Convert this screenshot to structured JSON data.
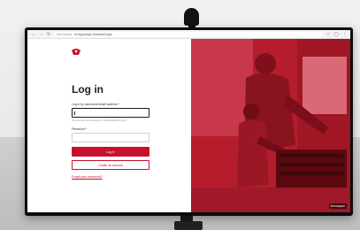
{
  "browser": {
    "secure_label": "Not secure",
    "url": "rb-loginpage.example/login"
  },
  "login": {
    "title": "Log in",
    "email_label": "Log in by username/email address *",
    "email_hint": "You can use your username or email address to log in",
    "password_label": "Password *",
    "login_button": "Log in",
    "create_account_button": "Create an account",
    "forgot_password_link": "Forgot your password?"
  },
  "hero": {
    "language_badge": "Monospace"
  },
  "colors": {
    "brand": "#c8102e"
  },
  "icons": {
    "back": "arrow-left-icon",
    "forward": "arrow-right-icon",
    "reload": "reload-icon",
    "menu": "menu-icon",
    "logo": "brand-logo"
  }
}
